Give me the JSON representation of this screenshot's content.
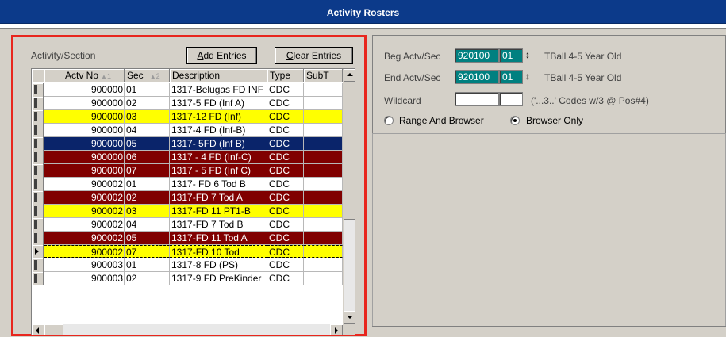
{
  "window": {
    "title": "Activity Rosters"
  },
  "left": {
    "section_label": "Activity/Section",
    "add_button": {
      "accel": "A",
      "rest": "dd Entries"
    },
    "clear_button": {
      "accel": "C",
      "rest": "lear Entries"
    },
    "columns": [
      {
        "label": "Actv No",
        "sort": "1"
      },
      {
        "label": "Sec",
        "sort": "2"
      },
      {
        "label": "Description"
      },
      {
        "label": "Type"
      },
      {
        "label": "SubT"
      }
    ],
    "rows": [
      {
        "actv": "900000",
        "sec": "01",
        "desc": "1317-Belugas FD INF",
        "type": "CDC",
        "style": "white"
      },
      {
        "actv": "900000",
        "sec": "02",
        "desc": "1317-5 FD (Inf A)",
        "type": "CDC",
        "style": "white"
      },
      {
        "actv": "900000",
        "sec": "03",
        "desc": "1317-12 FD (Inf)",
        "type": "CDC",
        "style": "yellow"
      },
      {
        "actv": "900000",
        "sec": "04",
        "desc": "1317-4 FD (Inf-B)",
        "type": "CDC",
        "style": "white"
      },
      {
        "actv": "900000",
        "sec": "05",
        "desc": "1317- 5FD (Inf B)",
        "type": "CDC",
        "style": "navy"
      },
      {
        "actv": "900000",
        "sec": "06",
        "desc": "1317 - 4 FD (Inf-C)",
        "type": "CDC",
        "style": "maroon"
      },
      {
        "actv": "900000",
        "sec": "07",
        "desc": "1317 - 5 FD (Inf C)",
        "type": "CDC",
        "style": "maroon"
      },
      {
        "actv": "900002",
        "sec": "01",
        "desc": "1317- FD 6 Tod B",
        "type": "CDC",
        "style": "white"
      },
      {
        "actv": "900002",
        "sec": "02",
        "desc": "1317-FD 7 Tod A",
        "type": "CDC",
        "style": "maroon"
      },
      {
        "actv": "900002",
        "sec": "03",
        "desc": "1317-FD 11 PT1-B",
        "type": "CDC",
        "style": "yellow"
      },
      {
        "actv": "900002",
        "sec": "04",
        "desc": "1317-FD 7 Tod B",
        "type": "CDC",
        "style": "white"
      },
      {
        "actv": "900002",
        "sec": "05",
        "desc": "1317-FD 11 Tod A",
        "type": "CDC",
        "style": "maroon"
      },
      {
        "actv": "900002",
        "sec": "07",
        "desc": "1317-FD 10 Tod",
        "type": "CDC",
        "style": "yellow",
        "current": true
      },
      {
        "actv": "900003",
        "sec": "01",
        "desc": "1317-8 FD (PS)",
        "type": "CDC",
        "style": "white"
      },
      {
        "actv": "900003",
        "sec": "02",
        "desc": "1317-9 FD PreKinder",
        "type": "CDC",
        "style": "white"
      }
    ]
  },
  "right": {
    "beg": {
      "label": "Beg Actv/Sec",
      "actv": "920100",
      "sec": "01",
      "desc": "TBall 4-5 Year Old"
    },
    "end": {
      "label": "End Actv/Sec",
      "actv": "920100",
      "sec": "01",
      "desc": "TBall 4-5 Year Old"
    },
    "wildcard": {
      "label": "Wildcard",
      "value1": "",
      "value2": "",
      "hint": "('...3..' Codes w/3 @ Pos#4)"
    },
    "radio_range": {
      "label": "Range And Browser",
      "checked": false
    },
    "radio_browser": {
      "label": "Browser Only",
      "checked": true
    }
  },
  "colors": {
    "title_bar": "#0c3a8a",
    "highlight_border": "#e8261e",
    "field_teal": "#008080",
    "row_yellow": "#ffff00",
    "row_maroon": "#800000",
    "row_navy": "#0a246a"
  }
}
